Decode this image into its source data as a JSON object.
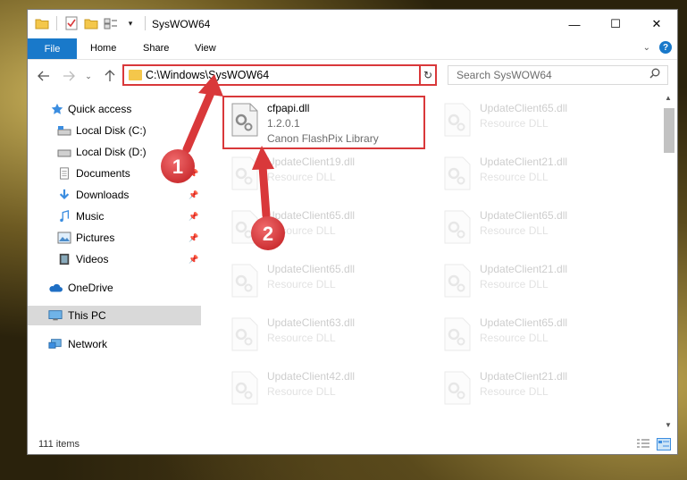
{
  "window": {
    "title": "SysWOW64",
    "controls": {
      "minimize": "—",
      "maximize": "☐",
      "close": "✕"
    }
  },
  "ribbon": {
    "tabs": [
      "File",
      "Home",
      "Share",
      "View"
    ],
    "help": "?"
  },
  "navigation": {
    "address_path": "C:\\Windows\\SysWOW64",
    "search_placeholder": "Search SysWOW64"
  },
  "sidebar": {
    "items": [
      {
        "label": "Quick access",
        "icon": "star-icon",
        "pinned": false
      },
      {
        "label": "Local Disk (C:)",
        "icon": "drive-icon",
        "pinned": false
      },
      {
        "label": "Local Disk (D:)",
        "icon": "drive-icon",
        "pinned": false
      },
      {
        "label": "Documents",
        "icon": "documents-icon",
        "pinned": true
      },
      {
        "label": "Downloads",
        "icon": "download-icon",
        "pinned": true
      },
      {
        "label": "Music",
        "icon": "music-icon",
        "pinned": true
      },
      {
        "label": "Pictures",
        "icon": "pictures-icon",
        "pinned": true
      },
      {
        "label": "Videos",
        "icon": "videos-icon",
        "pinned": true
      },
      {
        "label": "OneDrive",
        "icon": "cloud-icon",
        "pinned": false
      },
      {
        "label": "This PC",
        "icon": "computer-icon",
        "pinned": false,
        "selected": true
      },
      {
        "label": "Network",
        "icon": "network-icon",
        "pinned": false
      }
    ]
  },
  "files": [
    {
      "name": "cfpapi.dll",
      "line2": "1.2.0.1",
      "line3": "Canon FlashPix Library",
      "highlighted": true
    },
    {
      "name": "UpdateClient65.dll",
      "line2": "Resource DLL",
      "line3": ""
    },
    {
      "name": "UpdateClient19.dll",
      "line2": "Resource DLL",
      "line3": ""
    },
    {
      "name": "UpdateClient21.dll",
      "line2": "Resource DLL",
      "line3": ""
    },
    {
      "name": "UpdateClient65.dll",
      "line2": "Resource DLL",
      "line3": ""
    },
    {
      "name": "UpdateClient65.dll",
      "line2": "Resource DLL",
      "line3": ""
    },
    {
      "name": "UpdateClient65.dll",
      "line2": "Resource DLL",
      "line3": ""
    },
    {
      "name": "UpdateClient21.dll",
      "line2": "Resource DLL",
      "line3": ""
    },
    {
      "name": "UpdateClient63.dll",
      "line2": "Resource DLL",
      "line3": ""
    },
    {
      "name": "UpdateClient65.dll",
      "line2": "Resource DLL",
      "line3": ""
    },
    {
      "name": "UpdateClient42.dll",
      "line2": "Resource DLL",
      "line3": ""
    },
    {
      "name": "UpdateClient21.dll",
      "line2": "Resource DLL",
      "line3": ""
    }
  ],
  "status": {
    "item_count": "111 items"
  },
  "annotations": [
    {
      "label": "1",
      "color": "#d9383a"
    },
    {
      "label": "2",
      "color": "#d9383a"
    }
  ]
}
